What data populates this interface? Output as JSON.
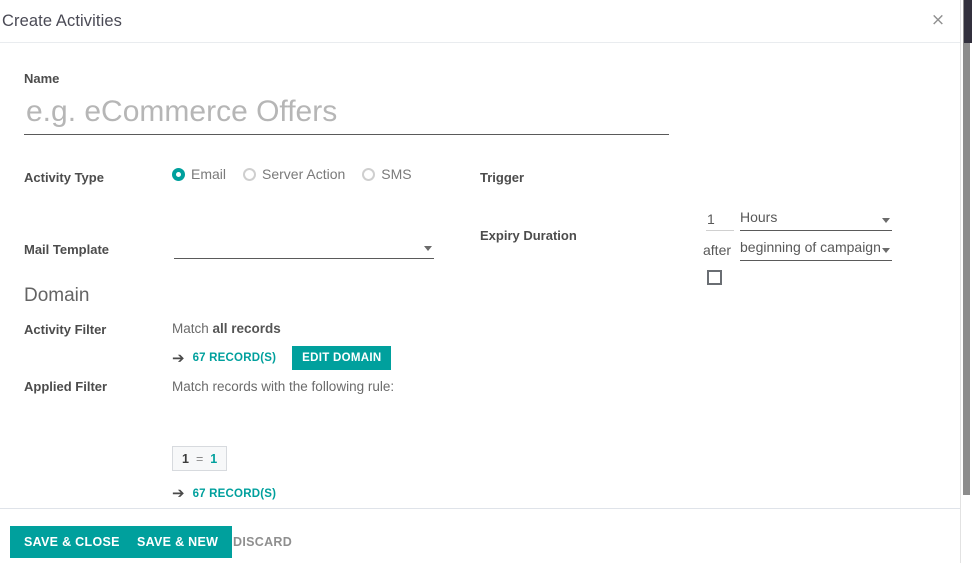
{
  "window": {
    "title": "Create Activities",
    "close_icon": "×"
  },
  "colors": {
    "primary": "#00a09d",
    "text": "#4c4c4c",
    "muted": "#8f8f8f",
    "divider": "#e9ecef"
  },
  "form": {
    "name": {
      "label": "Name",
      "value": "",
      "placeholder": "e.g. eCommerce Offers"
    },
    "activity_type": {
      "label": "Activity Type",
      "options": [
        {
          "label": "Email",
          "selected": true
        },
        {
          "label": "Server Action",
          "selected": false
        },
        {
          "label": "SMS",
          "selected": false
        }
      ]
    },
    "mail_template": {
      "label": "Mail Template",
      "value": "",
      "caret": "▾"
    },
    "trigger": {
      "label": "Trigger",
      "interval_number": "1",
      "interval_unit": "Hours",
      "relative_word": "after",
      "relative_to": "beginning of campaign"
    },
    "expiry_duration": {
      "label": "Expiry Duration",
      "checked": false
    }
  },
  "domain": {
    "heading": "Domain",
    "activity_filter": {
      "label": "Activity Filter",
      "match_prefix": "Match ",
      "match_strong": "all records",
      "arrow_icon": "➔",
      "record_count_link": "67 RECORD(S)",
      "edit_domain_button": "EDIT DOMAIN"
    },
    "applied_filter": {
      "label": "Applied Filter",
      "rule_text": "Match records with the following rule:",
      "rule": {
        "field": "1",
        "operator": "=",
        "value": "1"
      },
      "arrow_icon": "➔",
      "record_count_link": "67 RECORD(S)"
    }
  },
  "footer": {
    "save_close_label": "SAVE & CLOSE",
    "save_new_label": "SAVE & NEW",
    "discard_label": "DISCARD"
  }
}
